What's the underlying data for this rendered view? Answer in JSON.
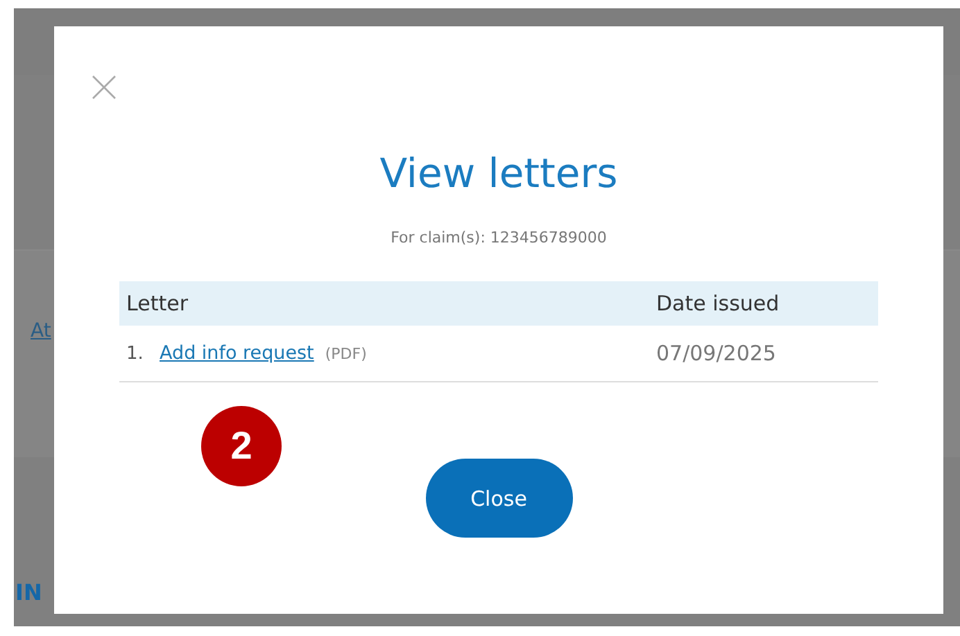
{
  "background": {
    "link": "At",
    "heading": "IN"
  },
  "dialog": {
    "title": "View letters",
    "subtitle": "For claim(s): 123456789000",
    "columns": [
      "Letter",
      "Date issued"
    ],
    "rows": [
      {
        "number": "1.",
        "letter": "Add info request",
        "format": "(PDF)",
        "date": "07/09/2025"
      }
    ],
    "button": "Close"
  },
  "step_badge": "2"
}
